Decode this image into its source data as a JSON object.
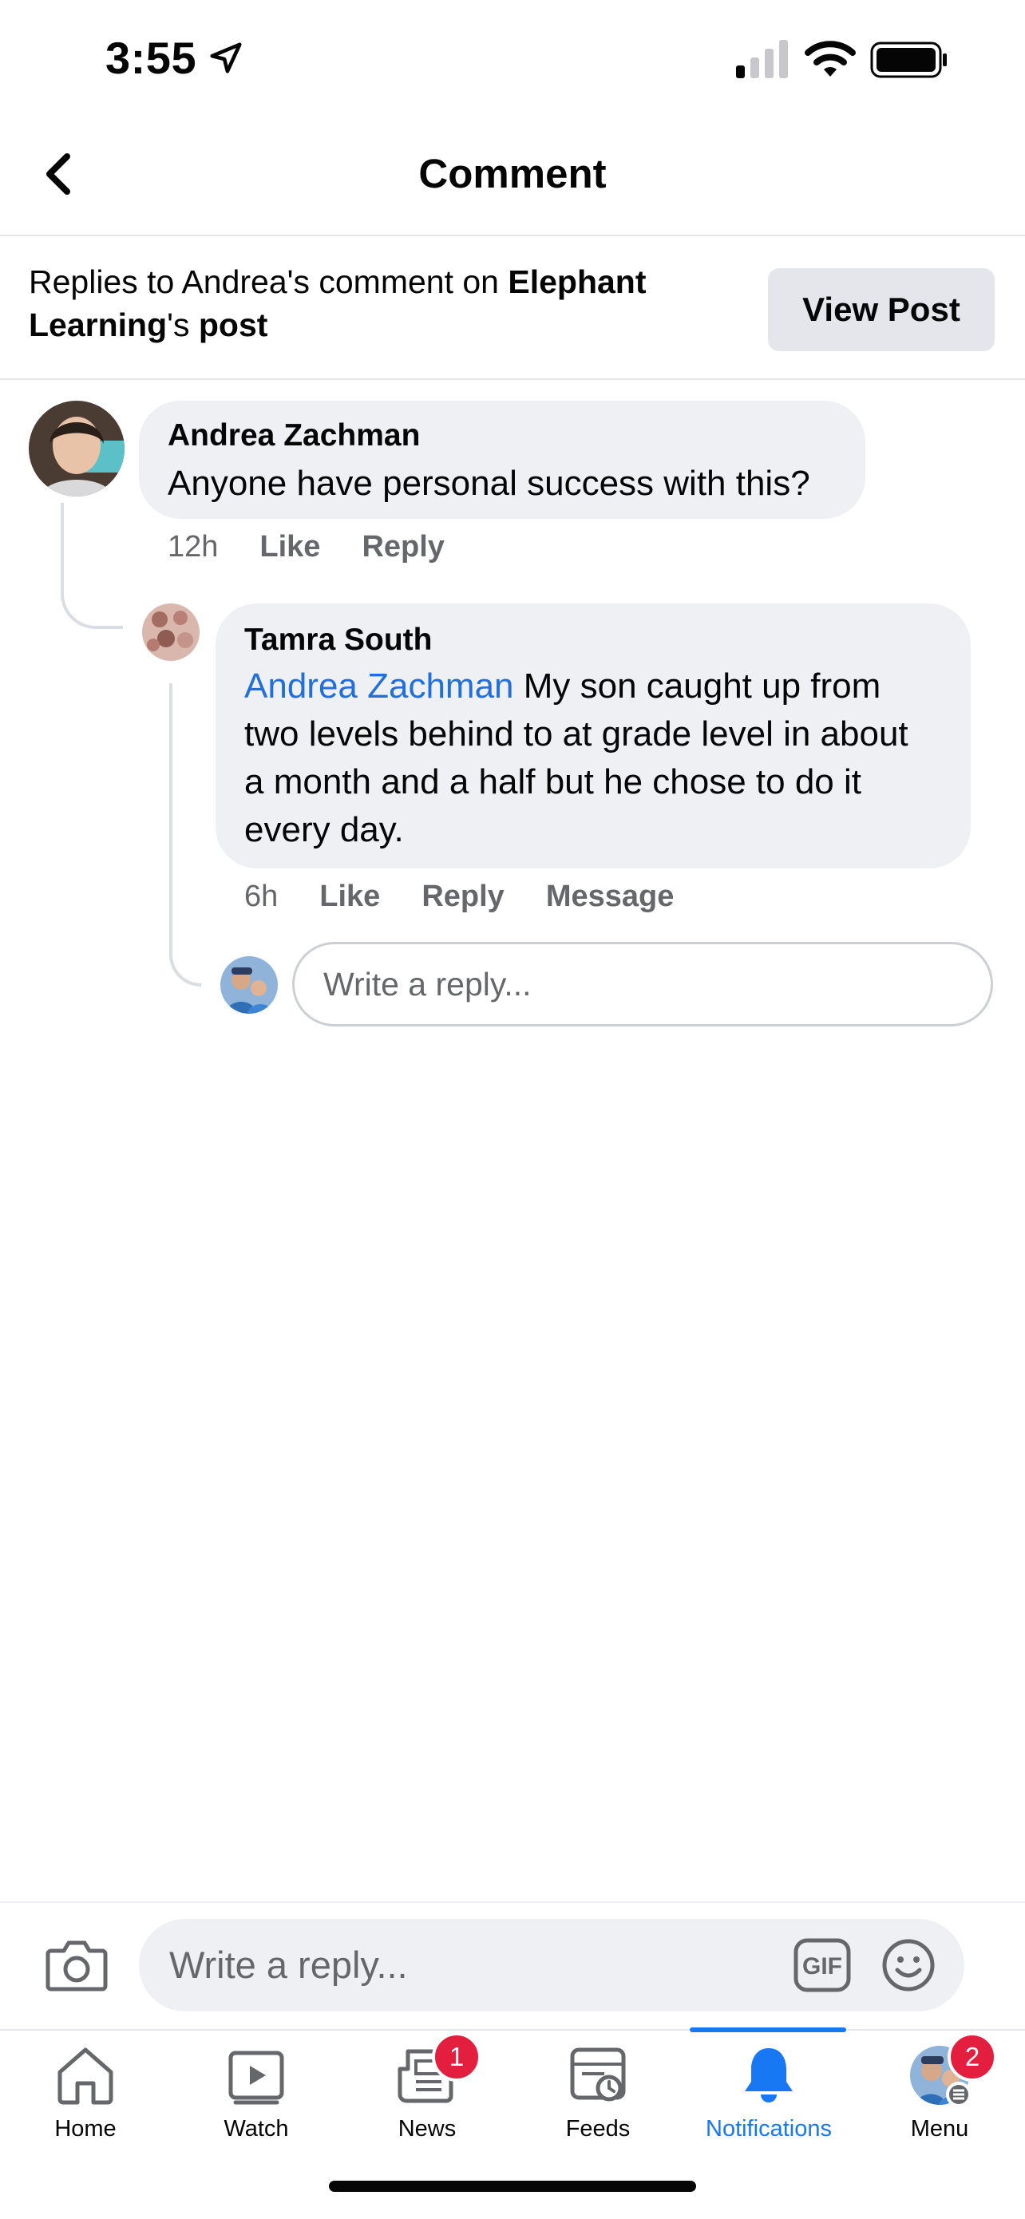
{
  "status_bar": {
    "time": "3:55"
  },
  "header": {
    "title": "Comment"
  },
  "context": {
    "prefix": "Replies to Andrea's comment on ",
    "page_name_1": "Elephant",
    "page_name_2": "Learning",
    "suffix_1": "'s ",
    "suffix_2": "post",
    "view_post_label": "View Post"
  },
  "comments": [
    {
      "author": "Andrea Zachman",
      "text": "Anyone have personal success with this?",
      "time": "12h",
      "actions": [
        "Like",
        "Reply"
      ]
    },
    {
      "author": "Tamra South",
      "mention": "Andrea Zachman",
      "text_line1_rest": " My son caught up from",
      "text_line2": "two levels behind to at grade level in about",
      "text_line3": "a month and a half but he chose to do it",
      "text_line4": "every day.",
      "time": "6h",
      "actions": [
        "Like",
        "Reply",
        "Message"
      ]
    }
  ],
  "inline_reply": {
    "placeholder": "Write a reply..."
  },
  "composer": {
    "placeholder": "Write a reply...",
    "gif_label": "GIF"
  },
  "tabs": [
    {
      "label": "Home",
      "icon": "home-icon"
    },
    {
      "label": "Watch",
      "icon": "watch-icon"
    },
    {
      "label": "News",
      "icon": "news-icon",
      "badge": "1"
    },
    {
      "label": "Feeds",
      "icon": "feeds-icon"
    },
    {
      "label": "Notifications",
      "icon": "bell-icon",
      "active": true
    },
    {
      "label": "Menu",
      "icon": "menu-avatar",
      "badge": "2"
    }
  ],
  "colors": {
    "accent": "#1877f2",
    "badge": "#e41e3f",
    "bubble": "#eff0f3",
    "mention": "#216fdb"
  }
}
